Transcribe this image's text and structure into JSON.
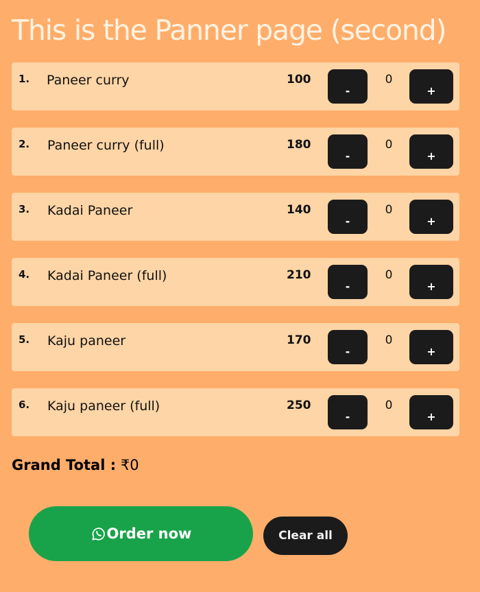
{
  "page": {
    "title": "This is the Panner page (second)"
  },
  "menu": {
    "items": [
      {
        "index": "1.",
        "name": "Paneer curry",
        "price": "100",
        "quantity": "0",
        "minus_label": "-",
        "plus_label": "+"
      },
      {
        "index": "2.",
        "name": "Paneer curry (full)",
        "price": "180",
        "quantity": "0",
        "minus_label": "-",
        "plus_label": "+"
      },
      {
        "index": "3.",
        "name": "Kadai Paneer",
        "price": "140",
        "quantity": "0",
        "minus_label": "-",
        "plus_label": "+"
      },
      {
        "index": "4.",
        "name": "Kadai Paneer (full)",
        "price": "210",
        "quantity": "0",
        "minus_label": "-",
        "plus_label": "+"
      },
      {
        "index": "5.",
        "name": "Kaju paneer",
        "price": "170",
        "quantity": "0",
        "minus_label": "-",
        "plus_label": "+"
      },
      {
        "index": "6.",
        "name": "Kaju paneer (full)",
        "price": "250",
        "quantity": "0",
        "minus_label": "-",
        "plus_label": "+"
      }
    ]
  },
  "summary": {
    "grand_total_label": "Grand Total :",
    "grand_total_value": "₹0"
  },
  "actions": {
    "order_label": "Order now",
    "order_icon": "whatsapp-icon",
    "clear_label": "Clear all"
  },
  "colors": {
    "background": "#FFAD6B",
    "row_background": "#FED5A6",
    "button_dark": "#1B1B1B",
    "order_green": "#18A34A",
    "title_text": "#FFF3E2"
  }
}
